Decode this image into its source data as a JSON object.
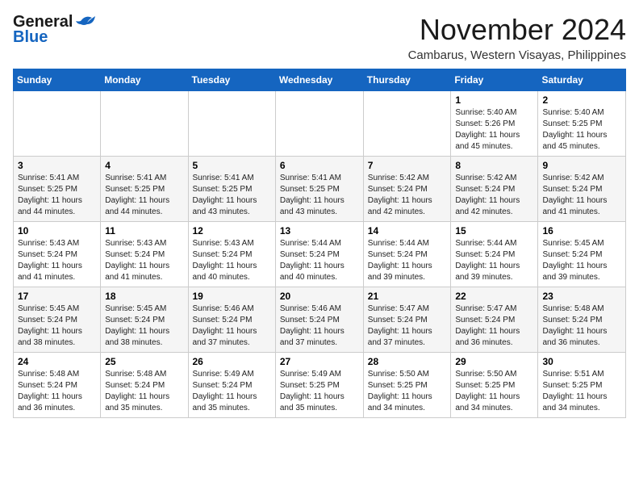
{
  "header": {
    "logo_general": "General",
    "logo_blue": "Blue",
    "month_title": "November 2024",
    "location": "Cambarus, Western Visayas, Philippines"
  },
  "calendar": {
    "days_of_week": [
      "Sunday",
      "Monday",
      "Tuesday",
      "Wednesday",
      "Thursday",
      "Friday",
      "Saturday"
    ],
    "weeks": [
      [
        {
          "day": "",
          "info": ""
        },
        {
          "day": "",
          "info": ""
        },
        {
          "day": "",
          "info": ""
        },
        {
          "day": "",
          "info": ""
        },
        {
          "day": "",
          "info": ""
        },
        {
          "day": "1",
          "info": "Sunrise: 5:40 AM\nSunset: 5:26 PM\nDaylight: 11 hours and 45 minutes."
        },
        {
          "day": "2",
          "info": "Sunrise: 5:40 AM\nSunset: 5:25 PM\nDaylight: 11 hours and 45 minutes."
        }
      ],
      [
        {
          "day": "3",
          "info": "Sunrise: 5:41 AM\nSunset: 5:25 PM\nDaylight: 11 hours and 44 minutes."
        },
        {
          "day": "4",
          "info": "Sunrise: 5:41 AM\nSunset: 5:25 PM\nDaylight: 11 hours and 44 minutes."
        },
        {
          "day": "5",
          "info": "Sunrise: 5:41 AM\nSunset: 5:25 PM\nDaylight: 11 hours and 43 minutes."
        },
        {
          "day": "6",
          "info": "Sunrise: 5:41 AM\nSunset: 5:25 PM\nDaylight: 11 hours and 43 minutes."
        },
        {
          "day": "7",
          "info": "Sunrise: 5:42 AM\nSunset: 5:24 PM\nDaylight: 11 hours and 42 minutes."
        },
        {
          "day": "8",
          "info": "Sunrise: 5:42 AM\nSunset: 5:24 PM\nDaylight: 11 hours and 42 minutes."
        },
        {
          "day": "9",
          "info": "Sunrise: 5:42 AM\nSunset: 5:24 PM\nDaylight: 11 hours and 41 minutes."
        }
      ],
      [
        {
          "day": "10",
          "info": "Sunrise: 5:43 AM\nSunset: 5:24 PM\nDaylight: 11 hours and 41 minutes."
        },
        {
          "day": "11",
          "info": "Sunrise: 5:43 AM\nSunset: 5:24 PM\nDaylight: 11 hours and 41 minutes."
        },
        {
          "day": "12",
          "info": "Sunrise: 5:43 AM\nSunset: 5:24 PM\nDaylight: 11 hours and 40 minutes."
        },
        {
          "day": "13",
          "info": "Sunrise: 5:44 AM\nSunset: 5:24 PM\nDaylight: 11 hours and 40 minutes."
        },
        {
          "day": "14",
          "info": "Sunrise: 5:44 AM\nSunset: 5:24 PM\nDaylight: 11 hours and 39 minutes."
        },
        {
          "day": "15",
          "info": "Sunrise: 5:44 AM\nSunset: 5:24 PM\nDaylight: 11 hours and 39 minutes."
        },
        {
          "day": "16",
          "info": "Sunrise: 5:45 AM\nSunset: 5:24 PM\nDaylight: 11 hours and 39 minutes."
        }
      ],
      [
        {
          "day": "17",
          "info": "Sunrise: 5:45 AM\nSunset: 5:24 PM\nDaylight: 11 hours and 38 minutes."
        },
        {
          "day": "18",
          "info": "Sunrise: 5:45 AM\nSunset: 5:24 PM\nDaylight: 11 hours and 38 minutes."
        },
        {
          "day": "19",
          "info": "Sunrise: 5:46 AM\nSunset: 5:24 PM\nDaylight: 11 hours and 37 minutes."
        },
        {
          "day": "20",
          "info": "Sunrise: 5:46 AM\nSunset: 5:24 PM\nDaylight: 11 hours and 37 minutes."
        },
        {
          "day": "21",
          "info": "Sunrise: 5:47 AM\nSunset: 5:24 PM\nDaylight: 11 hours and 37 minutes."
        },
        {
          "day": "22",
          "info": "Sunrise: 5:47 AM\nSunset: 5:24 PM\nDaylight: 11 hours and 36 minutes."
        },
        {
          "day": "23",
          "info": "Sunrise: 5:48 AM\nSunset: 5:24 PM\nDaylight: 11 hours and 36 minutes."
        }
      ],
      [
        {
          "day": "24",
          "info": "Sunrise: 5:48 AM\nSunset: 5:24 PM\nDaylight: 11 hours and 36 minutes."
        },
        {
          "day": "25",
          "info": "Sunrise: 5:48 AM\nSunset: 5:24 PM\nDaylight: 11 hours and 35 minutes."
        },
        {
          "day": "26",
          "info": "Sunrise: 5:49 AM\nSunset: 5:24 PM\nDaylight: 11 hours and 35 minutes."
        },
        {
          "day": "27",
          "info": "Sunrise: 5:49 AM\nSunset: 5:25 PM\nDaylight: 11 hours and 35 minutes."
        },
        {
          "day": "28",
          "info": "Sunrise: 5:50 AM\nSunset: 5:25 PM\nDaylight: 11 hours and 34 minutes."
        },
        {
          "day": "29",
          "info": "Sunrise: 5:50 AM\nSunset: 5:25 PM\nDaylight: 11 hours and 34 minutes."
        },
        {
          "day": "30",
          "info": "Sunrise: 5:51 AM\nSunset: 5:25 PM\nDaylight: 11 hours and 34 minutes."
        }
      ]
    ]
  }
}
